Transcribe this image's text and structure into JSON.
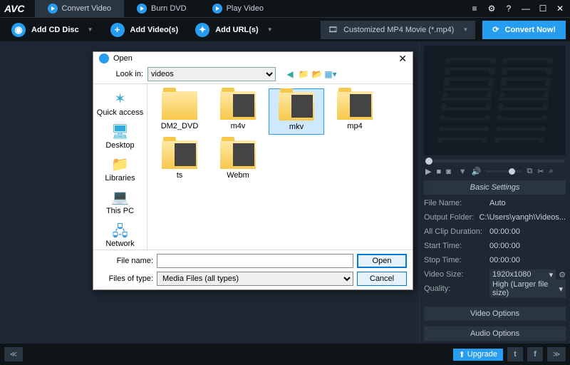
{
  "app": {
    "logo": "AVC"
  },
  "tabs": {
    "convert": "Convert Video",
    "burn": "Burn DVD",
    "play": "Play Video"
  },
  "win": {
    "settings": "⚙",
    "help": "?",
    "min": "—",
    "max": "☐",
    "close": "✕",
    "menu": "≡"
  },
  "toolbar": {
    "addcd": "Add CD Disc",
    "addvid": "Add Video(s)",
    "addurl": "Add URL(s)"
  },
  "profile": {
    "label": "Customized MP4 Movie (*.mp4)"
  },
  "convert": {
    "label": "Convert Now!"
  },
  "basic": {
    "heading": "Basic Settings",
    "rows": [
      {
        "lbl": "File Name:",
        "val": "Auto"
      },
      {
        "lbl": "Output Folder:",
        "val": "C:\\Users\\yangh\\Videos..."
      },
      {
        "lbl": "All Clip Duration:",
        "val": "00:00:00"
      },
      {
        "lbl": "Start Time:",
        "val": "00:00:00"
      },
      {
        "lbl": "Stop Time:",
        "val": "00:00:00"
      }
    ],
    "videosize": {
      "lbl": "Video Size:",
      "val": "1920x1080"
    },
    "quality": {
      "lbl": "Quality:",
      "val": "High (Larger file size)"
    }
  },
  "opts": {
    "video": "Video Options",
    "audio": "Audio Options"
  },
  "footer": {
    "upgrade": "Upgrade"
  },
  "dialog": {
    "title": "Open",
    "lookin_lbl": "Look in:",
    "lookin_val": "videos",
    "places": [
      "Quick access",
      "Desktop",
      "Libraries",
      "This PC",
      "Network"
    ],
    "folders": [
      {
        "name": "DM2_DVD",
        "thumb": false
      },
      {
        "name": "m4v",
        "thumb": true
      },
      {
        "name": "mkv",
        "thumb": true,
        "sel": true
      },
      {
        "name": "mp4",
        "thumb": true
      },
      {
        "name": "ts",
        "thumb": true
      },
      {
        "name": "Webm",
        "thumb": true
      }
    ],
    "filename_lbl": "File name:",
    "filename_val": "",
    "filetype_lbl": "Files of type:",
    "filetype_val": "Media Files (all types)",
    "open_btn": "Open",
    "cancel_btn": "Cancel"
  }
}
